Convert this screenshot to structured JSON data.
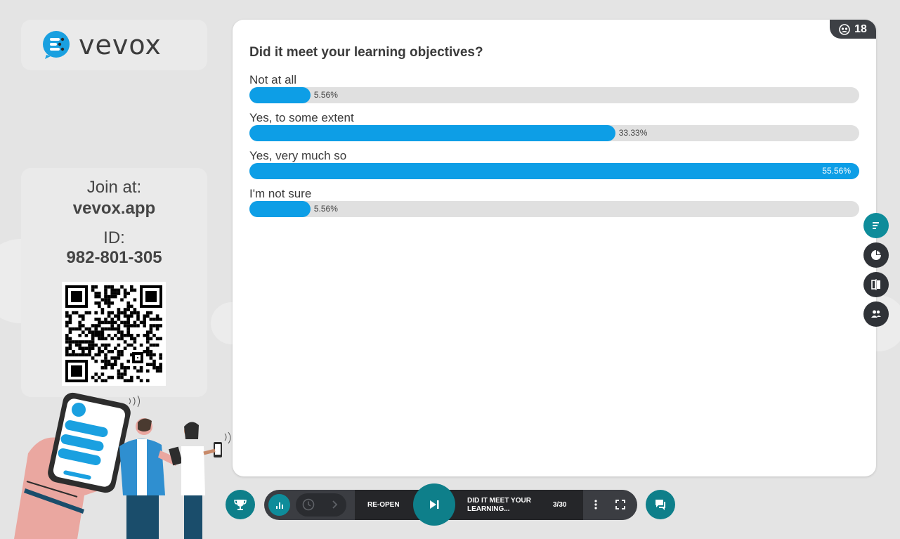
{
  "branding": {
    "logo_text": "vevox"
  },
  "join": {
    "join_label": "Join at:",
    "join_url": "vevox.app",
    "id_label": "ID:",
    "id_value": "982-801-305"
  },
  "poll": {
    "response_count": "18",
    "question": "Did it meet your learning objectives?",
    "options": [
      {
        "label": "Not at all",
        "percent_text": "5.56%",
        "percent": 5.56
      },
      {
        "label": "Yes, to some extent",
        "percent_text": "33.33%",
        "percent": 33.33
      },
      {
        "label": "Yes, very much so",
        "percent_text": "55.56%",
        "percent": 55.56
      },
      {
        "label": "I'm not sure",
        "percent_text": "5.56%",
        "percent": 5.56
      }
    ]
  },
  "toolbar": {
    "reopen_label": "RE-OPEN",
    "current_question": "DID IT MEET YOUR LEARNING...",
    "position": "3/30"
  },
  "colors": {
    "bar": "#0d9ee6",
    "accent": "#0e8c9a",
    "dark": "#3b3d42"
  },
  "icons": {
    "side_buttons": [
      "bar-chart-list-icon",
      "pie-chart-icon",
      "compare-icon",
      "people-icon"
    ],
    "toolbar": [
      "trophy-icon",
      "bars-icon",
      "clock-icon",
      "chevron-right-icon",
      "skip-next-icon",
      "more-vertical-icon",
      "fullscreen-icon",
      "chat-icon"
    ]
  }
}
